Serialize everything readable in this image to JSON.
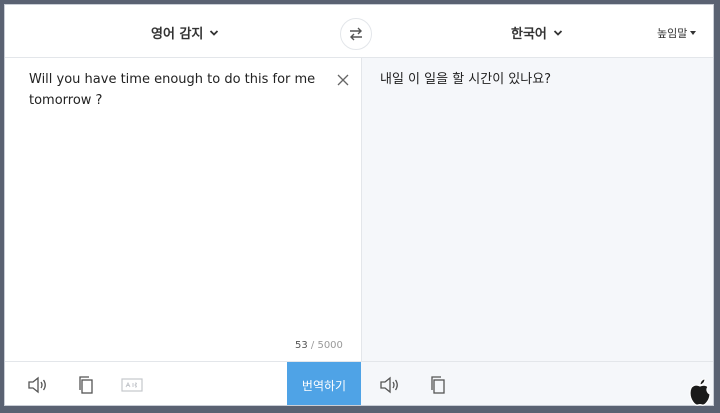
{
  "header": {
    "source_language": "영어 감지",
    "target_language": "한국어",
    "honorific": "높임말"
  },
  "source": {
    "text": "Will you have time enough to do this for me tomorrow ?",
    "char_count": "53",
    "char_limit": " / 5000"
  },
  "target": {
    "text": "내일 이 일을 할 시간이 있나요?"
  },
  "actions": {
    "translate_label": "번역하기"
  },
  "icons": [
    "chevron-down-icon",
    "swap-icon",
    "close-icon",
    "speaker-icon",
    "copy-icon",
    "handwriting-icon",
    "apple-logo"
  ],
  "colors": {
    "translate_button": "#4fa3e6",
    "target_background": "#f5f7fa"
  }
}
